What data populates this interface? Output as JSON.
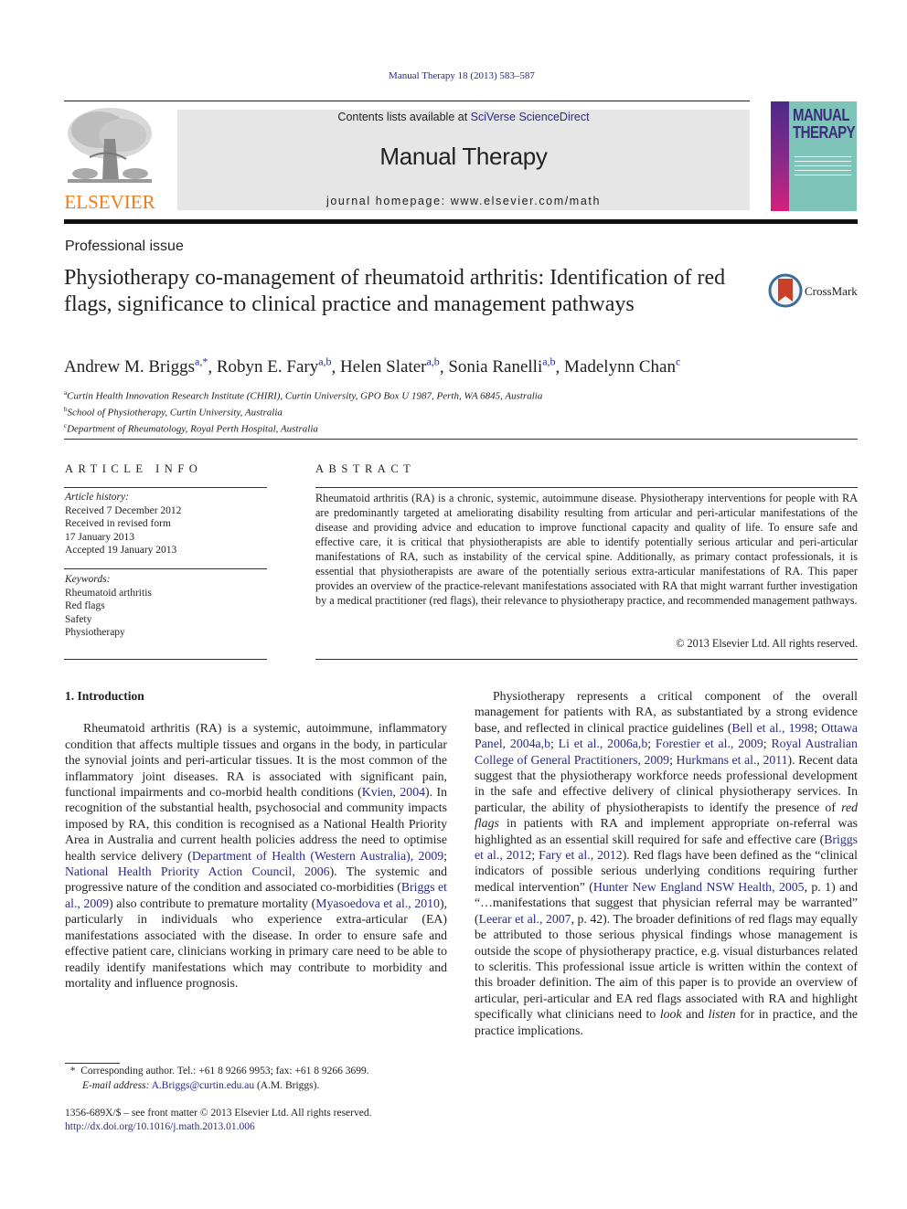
{
  "header": {
    "citation": "Manual Therapy 18 (2013) 583–587",
    "contents_prefix": "Contents lists available at ",
    "contents_link": "SciVerse ScienceDirect",
    "journal_name": "Manual Therapy",
    "homepage": "journal homepage: www.elsevier.com/math",
    "publisher_logo_text": "ELSEVIER",
    "cover_title_line1": "MANUAL",
    "cover_title_line2": "THERAPY",
    "brand_color": "#f07c1b",
    "link_color": "#2a2a8a"
  },
  "article": {
    "section_type": "Professional issue",
    "title": "Physiotherapy co-management of rheumatoid arthritis: Identification of red flags, significance to clinical practice and management pathways",
    "crossmark_label": "CrossMark",
    "authors": [
      {
        "name": "Andrew M. Briggs",
        "sup": "a,*"
      },
      {
        "name": "Robyn E. Fary",
        "sup": "a,b"
      },
      {
        "name": "Helen Slater",
        "sup": "a,b"
      },
      {
        "name": "Sonia Ranelli",
        "sup": "a,b"
      },
      {
        "name": "Madelynn Chan",
        "sup": "c"
      }
    ],
    "affiliations": [
      {
        "key": "a",
        "text": "Curtin Health Innovation Research Institute (CHIRI), Curtin University, GPO Box U 1987, Perth, WA 6845, Australia"
      },
      {
        "key": "b",
        "text": "School of Physiotherapy, Curtin University, Australia"
      },
      {
        "key": "c",
        "text": "Department of Rheumatology, Royal Perth Hospital, Australia"
      }
    ]
  },
  "article_info": {
    "heading": "ARTICLE INFO",
    "history_label": "Article history:",
    "history": [
      "Received 7 December 2012",
      "Received in revised form",
      "17 January 2013",
      "Accepted 19 January 2013"
    ],
    "keywords_label": "Keywords:",
    "keywords": [
      "Rheumatoid arthritis",
      "Red flags",
      "Safety",
      "Physiotherapy"
    ]
  },
  "abstract": {
    "heading": "ABSTRACT",
    "text": "Rheumatoid arthritis (RA) is a chronic, systemic, autoimmune disease. Physiotherapy interventions for people with RA are predominantly targeted at ameliorating disability resulting from articular and peri-articular manifestations of the disease and providing advice and education to improve functional capacity and quality of life. To ensure safe and effective care, it is critical that physiotherapists are able to identify potentially serious articular and peri-articular manifestations of RA, such as instability of the cervical spine. Additionally, as primary contact professionals, it is essential that physiotherapists are aware of the potentially serious extra-articular manifestations of RA. This paper provides an overview of the practice-relevant manifestations associated with RA that might warrant further investigation by a medical practitioner (red flags), their relevance to physiotherapy practice, and recommended management pathways.",
    "copyright": "© 2013 Elsevier Ltd. All rights reserved."
  },
  "body": {
    "intro_heading": "1.  Introduction",
    "left_para": [
      {
        "t": "Rheumatoid arthritis (RA) is a systemic, autoimmune, inflammatory condition that affects multiple tissues and organs in the body, in particular the synovial joints and peri-articular tissues. It is the most common of the inflammatory joint diseases. RA is associated with significant pain, functional impairments and co-morbid health conditions ("
      },
      {
        "l": "Kvien, 2004"
      },
      {
        "t": "). In recognition of the substantial health, psychosocial and community impacts imposed by RA, this condition is recognised as a National Health Priority Area in Australia and current health policies address the need to optimise health service delivery ("
      },
      {
        "l": "Department of Health (Western Australia), 2009"
      },
      {
        "t": "; "
      },
      {
        "l": "National Health Priority Action Council, 2006"
      },
      {
        "t": "). The systemic and progressive nature of the condition and associated co-morbidities ("
      },
      {
        "l": "Briggs et al., 2009"
      },
      {
        "t": ") also contribute to premature mortality ("
      },
      {
        "l": "Myasoedova et al., 2010"
      },
      {
        "t": "), particularly in individuals who experience extra-articular (EA) manifestations associated with the disease. In order to ensure safe and effective patient care, clinicians working in primary care need to be able to readily identify manifestations which may contribute to morbidity and mortality and influence prognosis."
      }
    ],
    "right_para": [
      {
        "t": "Physiotherapy represents a critical component of the overall management for patients with RA, as substantiated by a strong evidence base, and reflected in clinical practice guidelines ("
      },
      {
        "l": "Bell et al., 1998"
      },
      {
        "t": "; "
      },
      {
        "l": "Ottawa Panel, 2004a,b"
      },
      {
        "t": "; "
      },
      {
        "l": "Li et al., 2006a,b"
      },
      {
        "t": "; "
      },
      {
        "l": "Forestier et al., 2009"
      },
      {
        "t": "; "
      },
      {
        "l": "Royal Australian College of General Practitioners, 2009"
      },
      {
        "t": "; "
      },
      {
        "l": "Hurkmans et al., 2011"
      },
      {
        "t": "). Recent data suggest that the physiotherapy workforce needs professional development in the safe and effective delivery of clinical physiotherapy services. In particular, the ability of physiotherapists to identify the presence of "
      },
      {
        "i": "red flags"
      },
      {
        "t": " in patients with RA and implement appropriate on-referral was highlighted as an essential skill required for safe and effective care ("
      },
      {
        "l": "Briggs et al., 2012"
      },
      {
        "t": "; "
      },
      {
        "l": "Fary et al., 2012"
      },
      {
        "t": "). Red flags have been defined as the “clinical indicators of possible serious underlying conditions requiring further medical intervention” ("
      },
      {
        "l": "Hunter New England NSW Health, 2005"
      },
      {
        "t": ", p. 1) and “…manifestations that suggest that physician referral may be warranted” ("
      },
      {
        "l": "Leerar et al., 2007"
      },
      {
        "t": ", p. 42). The broader definitions of red flags may equally be attributed to those serious physical findings whose management is outside the scope of physiotherapy practice, e.g. visual disturbances related to scleritis. This professional issue article is written within the context of this broader definition. The aim of this paper is to provide an overview of articular, peri-articular and EA red flags associated with RA and highlight specifically what clinicians need to "
      },
      {
        "i": "look"
      },
      {
        "t": " and "
      },
      {
        "i": "listen"
      },
      {
        "t": " for in practice, and the practice implications."
      }
    ]
  },
  "footnotes": {
    "corresponding": "Corresponding author. Tel.: +61 8 9266 9953; fax: +61 8 9266 3699.",
    "corresponding_mark": "*",
    "email_label": "E-mail address:",
    "email": "A.Briggs@curtin.edu.au",
    "email_suffix": " (A.M. Briggs).",
    "issn_line": "1356-689X/$ – see front matter © 2013 Elsevier Ltd. All rights reserved.",
    "doi": "http://dx.doi.org/10.1016/j.math.2013.01.006"
  }
}
